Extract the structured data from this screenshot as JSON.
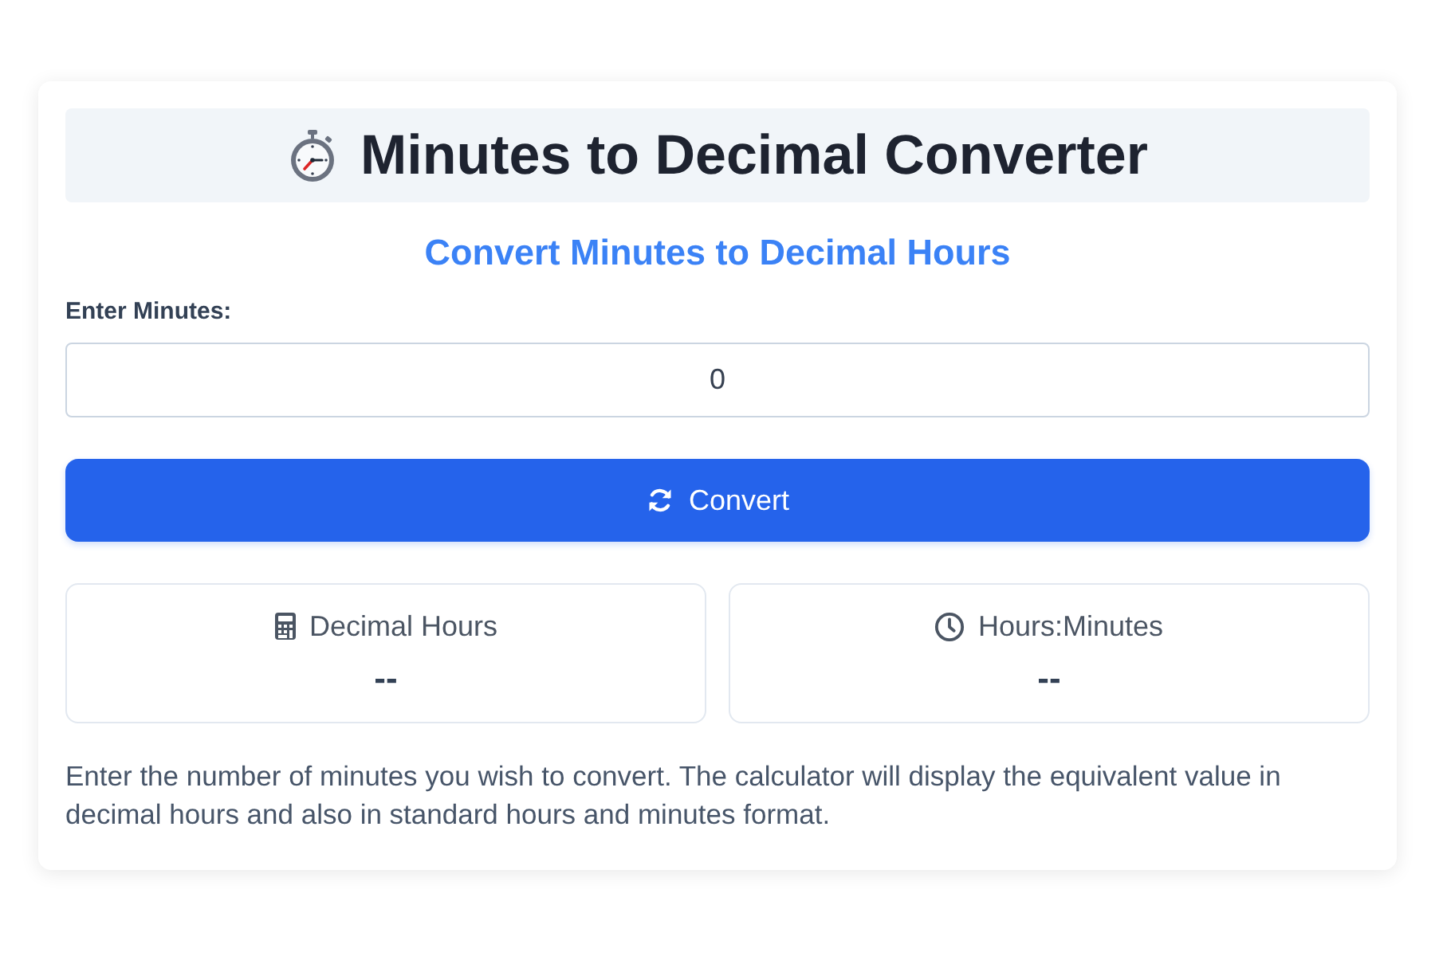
{
  "header": {
    "title": "Minutes to Decimal Converter"
  },
  "subtitle": "Convert Minutes to Decimal Hours",
  "input": {
    "label": "Enter Minutes:",
    "value": "0"
  },
  "convert_button": {
    "label": "Convert"
  },
  "results": [
    {
      "kind": "decimal",
      "label": "Decimal Hours",
      "value": "--"
    },
    {
      "kind": "hours_minutes",
      "label": "Hours:Minutes",
      "value": "--"
    }
  ],
  "description": "Enter the number of minutes you wish to convert. The calculator will display the equivalent value in decimal hours and also in standard hours and minutes format."
}
